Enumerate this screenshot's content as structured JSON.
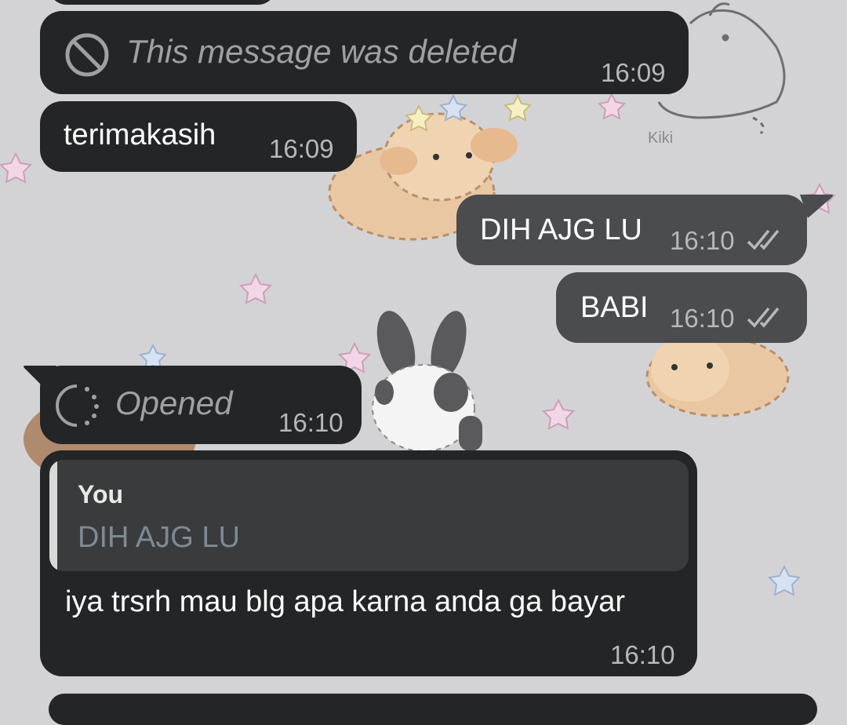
{
  "messages": [
    {
      "id": "deleted",
      "direction": "incoming",
      "text": "This message was deleted",
      "time": "16:09",
      "icon": "deleted-icon"
    },
    {
      "id": "thanks",
      "direction": "incoming",
      "text": "terimakasih",
      "time": "16:09"
    },
    {
      "id": "dih",
      "direction": "outgoing",
      "text": "DIH AJG LU",
      "time": "16:10",
      "status_icon": "double-check-icon"
    },
    {
      "id": "babi",
      "direction": "outgoing",
      "text": "BABI",
      "time": "16:10",
      "status_icon": "double-check-icon"
    },
    {
      "id": "opened",
      "direction": "incoming",
      "text": "Opened",
      "time": "16:10",
      "icon": "view-once-opened-icon"
    },
    {
      "id": "reply",
      "direction": "incoming",
      "quote": {
        "author": "You",
        "text": "DIH AJG LU"
      },
      "text": "iya trsrh mau blg apa karna anda ga bayar",
      "time": "16:10"
    }
  ],
  "wallpaper": {
    "signature": "Kiki"
  },
  "colors": {
    "background": "#d3d3d5",
    "incoming_bubble": "#232526",
    "outgoing_bubble": "#4b4c4e",
    "timestamp": "#b6b8ba"
  }
}
